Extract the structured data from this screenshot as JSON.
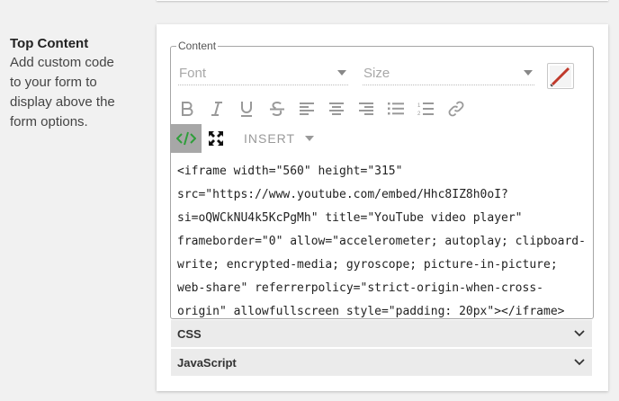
{
  "sidebar": {
    "title": "Top Content",
    "description_lines": [
      "Add custom code",
      "to your form to",
      "display above the",
      "form options."
    ]
  },
  "editor": {
    "legend": "Content",
    "font_placeholder": "Font",
    "size_placeholder": "Size",
    "insert_label": "INSERT",
    "code_lines": [
      "<iframe width=\"560\" height=\"315\"",
      "src=\"https://www.youtube.com/embed/Hhc8IZ8h0oI?",
      "si=oQWCkNU4k5KcPgMh\" title=\"YouTube video player\"",
      "frameborder=\"0\" allow=\"accelerometer; autoplay; clipboard-",
      "write; encrypted-media; gyroscope; picture-in-picture;",
      "web-share\" referrerpolicy=\"strict-origin-when-cross-",
      "origin\" allowfullscreen style=\"padding: 20px\"></iframe>"
    ],
    "toolbar_icons": [
      "bold-icon",
      "italic-icon",
      "underline-icon",
      "strikethrough-icon",
      "align-left-icon",
      "align-center-icon",
      "align-right-icon",
      "bulleted-list-icon",
      "numbered-list-icon",
      "link-icon",
      "code-view-icon",
      "fullscreen-icon",
      "color-picker-icon"
    ]
  },
  "accordions": {
    "css_label": "CSS",
    "js_label": "JavaScript"
  },
  "colors": {
    "code_view_active_bg": "#a7a7a7",
    "code_icon": "#2e9e3a",
    "color_swatch": "#c0392b"
  }
}
